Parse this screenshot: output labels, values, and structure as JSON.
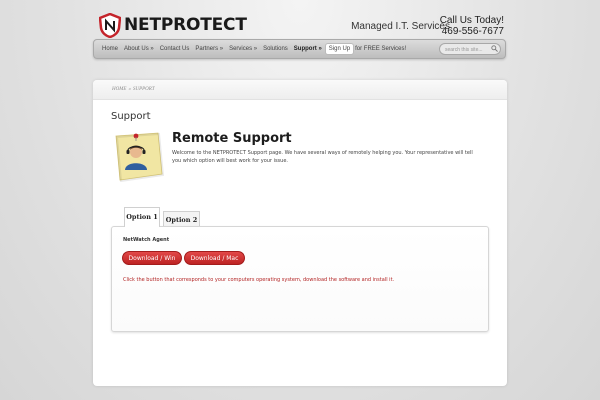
{
  "brand": {
    "name": "NETPROTECT",
    "accent": "#c4242b"
  },
  "header": {
    "tagline": "Managed I.T. Services",
    "call_label": "Call Us Today!",
    "phone": "469-556-7677"
  },
  "nav": {
    "items": [
      {
        "label": "Home"
      },
      {
        "label": "About Us »"
      },
      {
        "label": "Contact Us"
      },
      {
        "label": "Partners »"
      },
      {
        "label": "Services »"
      },
      {
        "label": "Solutions"
      },
      {
        "label": "Support »"
      }
    ],
    "active": "Support »",
    "signup_label": "Sign Up",
    "signup_tail": "for FREE Services!",
    "search_placeholder": "search this site..."
  },
  "breadcrumb": {
    "home": "HOME",
    "separator": "»",
    "current": "SUPPORT"
  },
  "page": {
    "title": "Support",
    "heading": "Remote Support",
    "intro": "Welcome to the NETPROTECT Support page. We have several ways of remotely helping you. Your representative will tell you which option will best work for your issue."
  },
  "tabs": [
    {
      "label": "Option 1"
    },
    {
      "label": "Option 2"
    }
  ],
  "tab_content": {
    "agent_title": "NetWatch Agent",
    "download_win": "Download / Win",
    "download_mac": "Download / Mac",
    "instructions": "Click the button that corresponds to your computers operating system, download the software and install it."
  },
  "colors": {
    "button": "#cc2e2e",
    "instruction_text": "#b22222"
  }
}
